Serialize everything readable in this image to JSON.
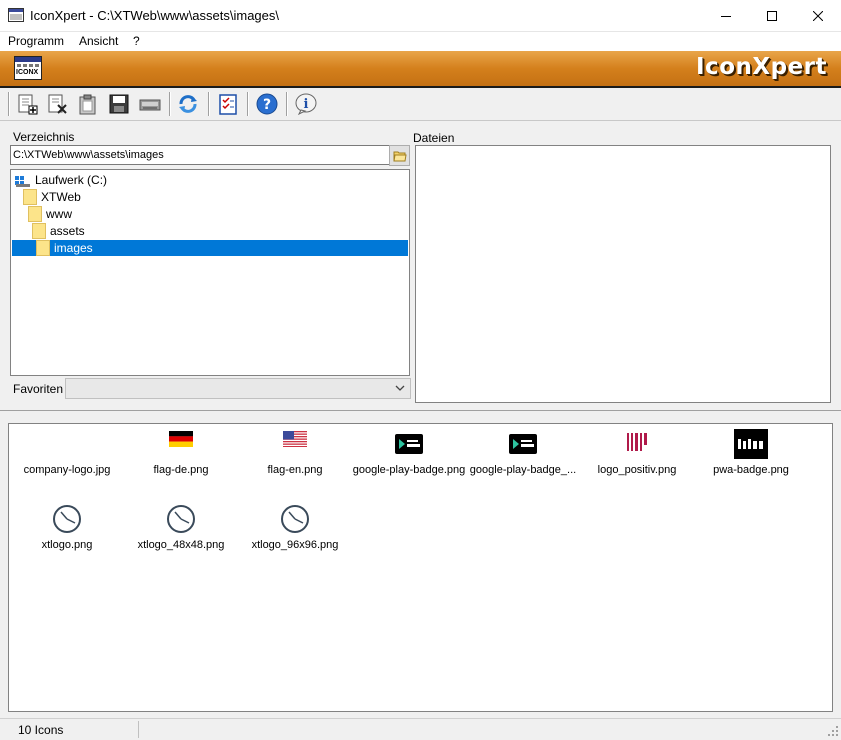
{
  "window": {
    "title": "IconXpert - C:\\XTWeb\\www\\assets\\images\\",
    "controls": [
      "minimize",
      "maximize",
      "close"
    ]
  },
  "menu": {
    "items": [
      "Programm",
      "Ansicht",
      "?"
    ]
  },
  "banner": {
    "title": "IconXpert",
    "icon_text": "ICONX"
  },
  "toolbar": {
    "buttons": [
      "new-icon",
      "delete-icon",
      "paste-icon",
      "save-icon",
      "scan-icon",
      "refresh-icon",
      "checklist-icon",
      "help-icon",
      "info-icon"
    ]
  },
  "directory": {
    "label": "Verzeichnis",
    "path": "C:\\XTWeb\\www\\assets\\images",
    "tree": [
      {
        "label": "Laufwerk (C:)",
        "level": 0,
        "selected": false
      },
      {
        "label": "XTWeb",
        "level": 1,
        "selected": false
      },
      {
        "label": "www",
        "level": 2,
        "selected": false
      },
      {
        "label": "assets",
        "level": 3,
        "selected": false
      },
      {
        "label": "images",
        "level": 4,
        "selected": true
      }
    ]
  },
  "favorites": {
    "label": "Favoriten",
    "value": ""
  },
  "files": {
    "label": "Dateien"
  },
  "icons": [
    {
      "name": "company-logo.jpg",
      "kind": "blank"
    },
    {
      "name": "flag-de.png",
      "kind": "flag-de"
    },
    {
      "name": "flag-en.png",
      "kind": "flag-us"
    },
    {
      "name": "google-play-badge.png",
      "kind": "gplay"
    },
    {
      "name": "google-play-badge_...",
      "kind": "gplay"
    },
    {
      "name": "logo_positiv.png",
      "kind": "logo-positiv"
    },
    {
      "name": "pwa-badge.png",
      "kind": "pwa"
    },
    {
      "name": "xtlogo.png",
      "kind": "clock"
    },
    {
      "name": "xtlogo_48x48.png",
      "kind": "clock"
    },
    {
      "name": "xtlogo_96x96.png",
      "kind": "clock"
    }
  ],
  "status": {
    "text": "10 Icons"
  },
  "colors": {
    "selection": "#0078d7",
    "banner": "#d4801c"
  }
}
